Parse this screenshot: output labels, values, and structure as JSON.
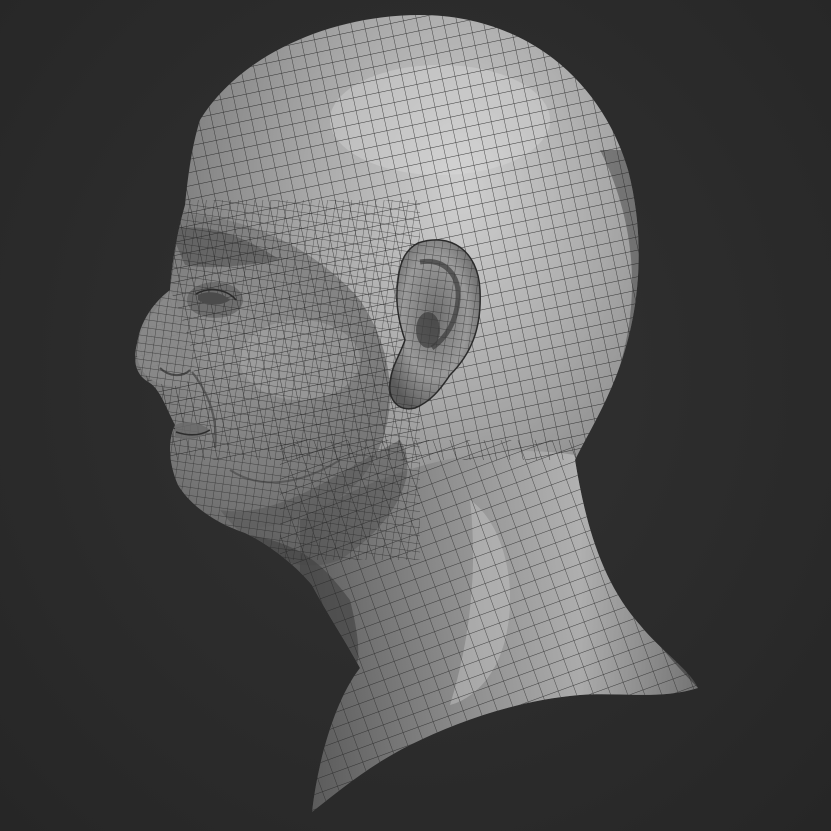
{
  "scene": {
    "background_color": "#2b2b2b",
    "model_base_color": "#8f8f8f",
    "wire_color": "#1e1e1e"
  }
}
